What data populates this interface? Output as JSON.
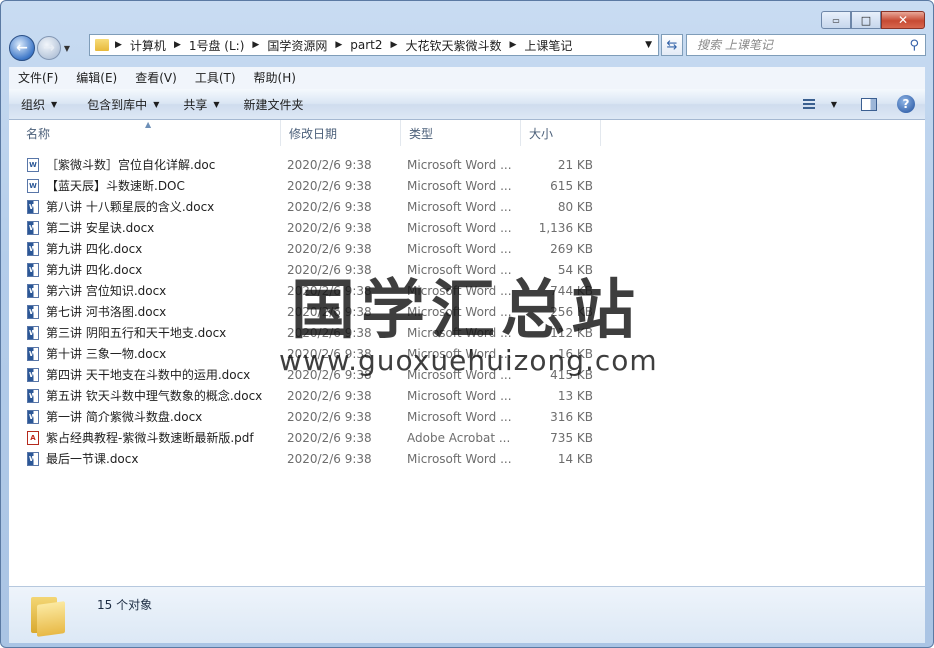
{
  "window": {
    "minimize_glyph": "▭",
    "maximize_glyph": "□",
    "close_glyph": "✕"
  },
  "address": {
    "crumbs": [
      "计算机",
      "1号盘 (L:)",
      "国学资源网",
      "part2",
      "大花钦天紫微斗数",
      "上课笔记"
    ]
  },
  "search": {
    "placeholder": "搜索 上课笔记"
  },
  "menu": [
    "文件(F)",
    "编辑(E)",
    "查看(V)",
    "工具(T)",
    "帮助(H)"
  ],
  "toolbar": {
    "organize": "组织",
    "include_library": "包含到库中",
    "share": "共享",
    "new_folder": "新建文件夹"
  },
  "columns": {
    "name": "名称",
    "date": "修改日期",
    "type": "类型",
    "size": "大小"
  },
  "files": [
    {
      "name": "［紫微斗数］宫位自化详解.doc",
      "date": "2020/2/6 9:38",
      "type": "Microsoft Word ...",
      "size": "21 KB",
      "icon": "doc"
    },
    {
      "name": "【蓝天辰】斗数速断.DOC",
      "date": "2020/2/6 9:38",
      "type": "Microsoft Word ...",
      "size": "615 KB",
      "icon": "doc"
    },
    {
      "name": "第八讲  十八颗星辰的含义.docx",
      "date": "2020/2/6 9:38",
      "type": "Microsoft Word ...",
      "size": "80 KB",
      "icon": "docx"
    },
    {
      "name": "第二讲  安星诀.docx",
      "date": "2020/2/6 9:38",
      "type": "Microsoft Word ...",
      "size": "1,136 KB",
      "icon": "docx"
    },
    {
      "name": "第九讲    四化.docx",
      "date": "2020/2/6 9:38",
      "type": "Microsoft Word ...",
      "size": "269 KB",
      "icon": "docx"
    },
    {
      "name": "第九讲 四化.docx",
      "date": "2020/2/6 9:38",
      "type": "Microsoft Word ...",
      "size": "54 KB",
      "icon": "docx"
    },
    {
      "name": "第六讲  宫位知识.docx",
      "date": "2020/2/6 9:38",
      "type": "Microsoft Word ...",
      "size": "744 KB",
      "icon": "docx"
    },
    {
      "name": "第七讲  河书洛图.docx",
      "date": "2020/2/6 9:38",
      "type": "Microsoft Word ...",
      "size": "256 KB",
      "icon": "docx"
    },
    {
      "name": "第三讲  阴阳五行和天干地支.docx",
      "date": "2020/2/6 9:38",
      "type": "Microsoft Word ...",
      "size": "112 KB",
      "icon": "docx"
    },
    {
      "name": "第十讲  三象一物.docx",
      "date": "2020/2/6 9:38",
      "type": "Microsoft Word ...",
      "size": "16 KB",
      "icon": "docx"
    },
    {
      "name": "第四讲 天干地支在斗数中的运用.docx",
      "date": "2020/2/6 9:38",
      "type": "Microsoft Word ...",
      "size": "415 KB",
      "icon": "docx"
    },
    {
      "name": "第五讲 钦天斗数中理气数象的概念.docx",
      "date": "2020/2/6 9:38",
      "type": "Microsoft Word ...",
      "size": "13 KB",
      "icon": "docx"
    },
    {
      "name": "第一讲 简介紫微斗数盘.docx",
      "date": "2020/2/6 9:38",
      "type": "Microsoft Word ...",
      "size": "316 KB",
      "icon": "docx"
    },
    {
      "name": "紫占经典教程-紫微斗数速断最新版.pdf",
      "date": "2020/2/6 9:38",
      "type": "Adobe Acrobat ...",
      "size": "735 KB",
      "icon": "pdf"
    },
    {
      "name": "最后一节课.docx",
      "date": "2020/2/6 9:38",
      "type": "Microsoft Word ...",
      "size": "14 KB",
      "icon": "docx"
    }
  ],
  "status": {
    "count": "15 个对象"
  },
  "watermark": {
    "cn": "国学汇总站",
    "url": "www.guoxuehuizong.com"
  }
}
